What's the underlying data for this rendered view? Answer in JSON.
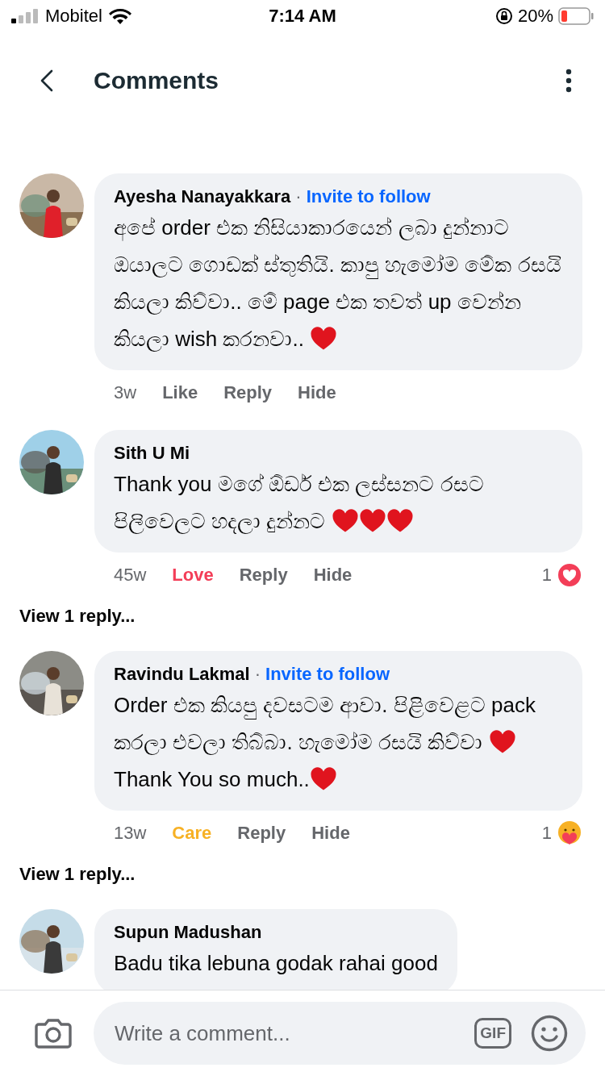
{
  "status_bar": {
    "carrier": "Mobitel",
    "time": "7:14 AM",
    "battery": "20%"
  },
  "header": {
    "title": "Comments"
  },
  "comments": [
    {
      "avatar": {
        "kind": "picture"
      },
      "name": "Ayesha Nanayakkara",
      "invite": {
        "separator": "·",
        "label": "Invite to follow"
      },
      "body": [
        {
          "kind": "text",
          "text": "අපේ order එක නිසියාකාරයෙන් ලබා දුන්නාට ඔයාලට ගොඩක් ස්තුතියි. කාපු හැමෝම මේක රසයි කියලා කිව්වා.. මේ page එක තවත් up වෙන්න කියලා wish කරනවා.. "
        },
        {
          "kind": "heart"
        }
      ],
      "meta": {
        "time": "3w",
        "reaction_button": {
          "label": "Like",
          "kind": "like",
          "selected": false
        },
        "reply": "Reply",
        "hide": "Hide"
      }
    },
    {
      "avatar": {
        "kind": "picture"
      },
      "name": "Sith U Mi",
      "body": [
        {
          "kind": "text",
          "text": "Thank you මගේ ඕඩර් එක ලස්සනට රසට පිලිවෙලට හදලා දුන්නට "
        },
        {
          "kind": "heart"
        },
        {
          "kind": "heart"
        },
        {
          "kind": "heart"
        }
      ],
      "meta": {
        "time": "45w",
        "reaction_button": {
          "label": "Love",
          "kind": "love",
          "selected": true
        },
        "reply": "Reply",
        "hide": "Hide",
        "reactions": {
          "count": "1",
          "kind": "love"
        }
      },
      "view_replies": "View 1 reply..."
    },
    {
      "avatar": {
        "kind": "picture"
      },
      "name": "Ravindu Lakmal",
      "invite": {
        "separator": "·",
        "label": "Invite to follow"
      },
      "body": [
        {
          "kind": "text",
          "text": "Order එක කියපු දවසටම ආවා. පිළිවෙළට pack කරලා එවලා තිබ්බා. හැමෝම රසයි කිව්වා "
        },
        {
          "kind": "heart"
        },
        {
          "kind": "text",
          "text": " Thank You so much.."
        },
        {
          "kind": "heart"
        }
      ],
      "meta": {
        "time": "13w",
        "reaction_button": {
          "label": "Care",
          "kind": "care",
          "selected": true
        },
        "reply": "Reply",
        "hide": "Hide",
        "reactions": {
          "count": "1",
          "kind": "care"
        }
      },
      "view_replies": "View 1 reply..."
    },
    {
      "avatar": {
        "kind": "picture"
      },
      "name": "Supun Madushan",
      "body": [
        {
          "kind": "text",
          "text": "Badu tika lebuna  godak  rahai good"
        }
      ]
    }
  ],
  "composer": {
    "placeholder": "Write a comment...",
    "gif_label": "GIF"
  }
}
